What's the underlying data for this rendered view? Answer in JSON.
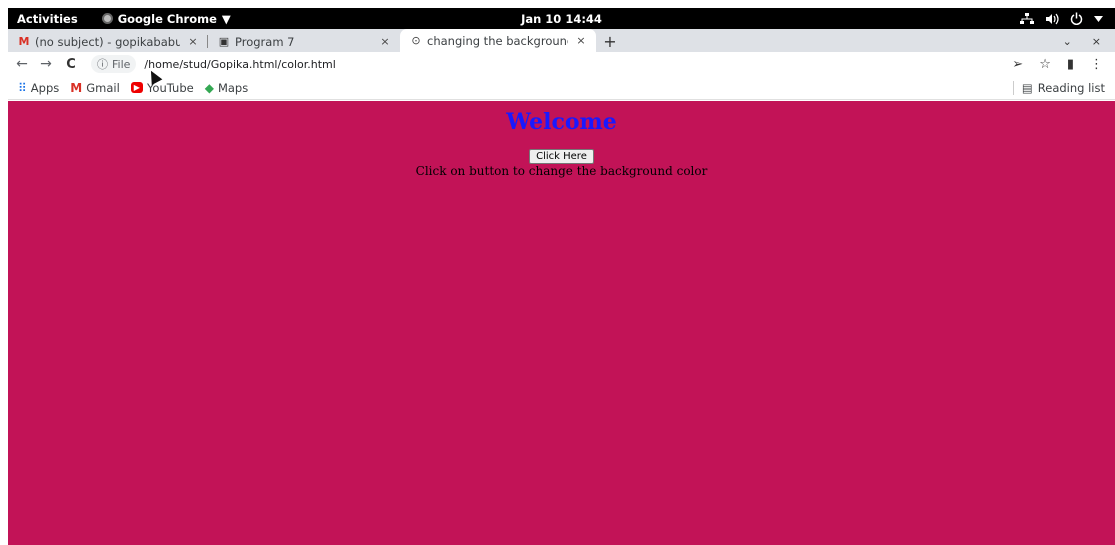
{
  "system_bar": {
    "activities": "Activities",
    "app_name": "Google Chrome",
    "app_menu_arrow": "▼",
    "clock": "Jan 10  14:44",
    "status_icons": [
      "network-icon",
      "volume-icon",
      "power-icon",
      "chevron-down-icon"
    ]
  },
  "tabs": [
    {
      "title": "(no subject) - gopikababu",
      "icon": "gmail-icon",
      "icon_glyph": "M",
      "close": "×"
    },
    {
      "title": "Program 7",
      "icon": "page-icon",
      "icon_glyph": "▣",
      "close": "×"
    },
    {
      "title": "changing the background",
      "icon": "globe-icon",
      "icon_glyph": "⊙",
      "close": "×",
      "active": true
    }
  ],
  "new_tab": "+",
  "tab_search": "⌄",
  "window_close": "×",
  "toolbar": {
    "back": "←",
    "forward": "→",
    "reload": "C",
    "chip_icon": "ⓘ",
    "chip_label": "File",
    "url": "/home/stud/Gopika.html/color.html",
    "send": "➢",
    "star": "☆",
    "extension": "▮",
    "menu": "⋮"
  },
  "bookmarks": [
    {
      "label": "Apps",
      "icon": "apps-icon",
      "glyph": "⠿"
    },
    {
      "label": "Gmail",
      "icon": "gmail-icon",
      "glyph": "M"
    },
    {
      "label": "YouTube",
      "icon": "youtube-icon",
      "glyph": "▶"
    },
    {
      "label": "Maps",
      "icon": "maps-icon",
      "glyph": "◆"
    }
  ],
  "reading_list": {
    "label": "Reading list",
    "glyph": "▤"
  },
  "page": {
    "heading": "Welcome",
    "button_label": "Click Here",
    "description": "Click on button to change the background color",
    "background_color": "#c21357",
    "heading_color": "#1919ff"
  }
}
